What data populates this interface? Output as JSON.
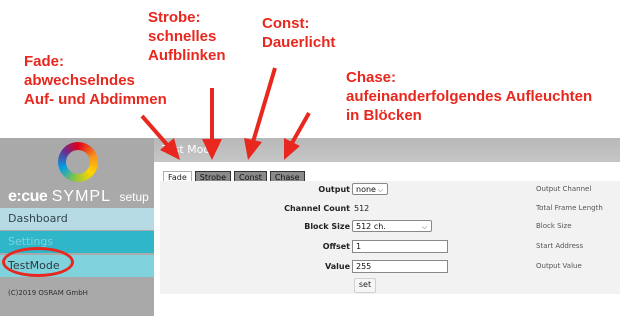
{
  "annotations": {
    "strobe": "Strobe:\nschnelles\nAufblinken",
    "const": "Const:\nDauerlicht",
    "fade": "Fade:\nabwechselndes\nAuf- und Abdimmen",
    "chase": "Chase:\naufeinanderfolgendes Aufleuchten\nin Blöcken",
    "color": "#e8281f"
  },
  "sidebar": {
    "brand_ecue": "e:cue",
    "brand_sympl": "SYMPL",
    "brand_setup": "setup",
    "items": [
      {
        "label": "Dashboard"
      },
      {
        "label": "Settings"
      },
      {
        "label": "TestMode"
      }
    ],
    "copyright": "(C)2019 OSRAM GmbH"
  },
  "header": {
    "title": "Test Mode"
  },
  "tabs": [
    {
      "label": "Fade",
      "active": true
    },
    {
      "label": "Strobe",
      "active": false
    },
    {
      "label": "Const",
      "active": false
    },
    {
      "label": "Chase",
      "active": false
    }
  ],
  "form": {
    "output": {
      "label": "Output",
      "value": "none",
      "desc": "Output Channel"
    },
    "channel": {
      "label": "Channel Count",
      "value": "512",
      "desc": "Total Frame Length"
    },
    "block": {
      "label": "Block Size",
      "value": "512 ch.",
      "desc": "Block Size"
    },
    "offset": {
      "label": "Offset",
      "value": "1",
      "desc": "Start Address"
    },
    "value": {
      "label": "Value",
      "value": "255",
      "desc": "Output Value"
    },
    "set_label": "set"
  }
}
